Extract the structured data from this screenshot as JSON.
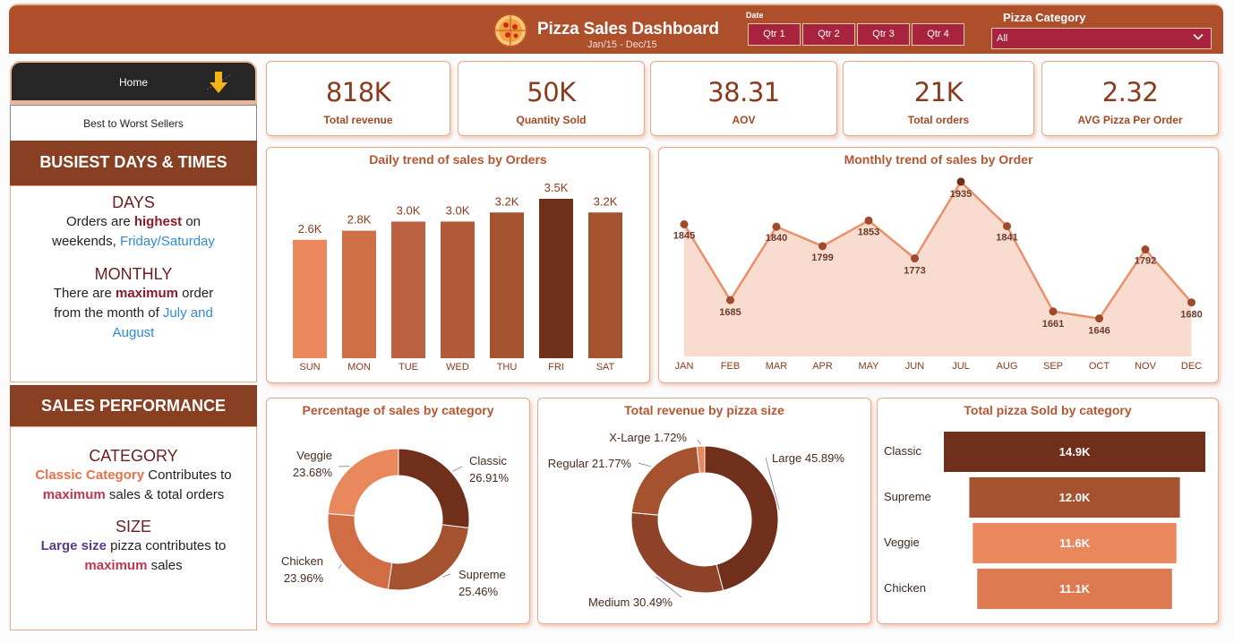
{
  "header": {
    "title": "Pizza Sales Dashboard",
    "subtitle": "Jan/15 - Dec/15",
    "date_label": "Date",
    "quarters": [
      "Qtr 1",
      "Qtr 2",
      "Qtr 3",
      "Qtr 4"
    ],
    "category_label": "Pizza Category",
    "category_value": "All"
  },
  "nav": {
    "home": "Home",
    "best": "Best to Worst Sellers"
  },
  "busiest": {
    "heading": "BUSIEST DAYS & TIMES",
    "days_title": "DAYS",
    "days_l1a": "Orders are ",
    "days_l1b": "highest",
    "days_l1c": " on",
    "days_l2a": "weekends, ",
    "days_l2b": "Friday/Saturday",
    "monthly_title": "MONTHLY",
    "mon_l1a": "There are ",
    "mon_l1b": "maximum",
    "mon_l1c": " order",
    "mon_l2a": "from the month of ",
    "mon_l2b": "July and",
    "mon_l3": "August"
  },
  "performance": {
    "heading": "SALES PERFORMANCE",
    "cat_title": "CATEGORY",
    "cat_l1a": "Classic Category",
    "cat_l1b": " Contributes to",
    "cat_l2a": "maximum",
    "cat_l2b": " sales & total orders",
    "size_title": "SIZE",
    "size_l1a": "Large size",
    "size_l1b": " pizza contributes to",
    "size_l2a": "maximum",
    "size_l2b": " sales"
  },
  "kpis": [
    {
      "value": "818K",
      "label": "Total revenue"
    },
    {
      "value": "50K",
      "label": "Quantity Sold"
    },
    {
      "value": "38.31",
      "label": "AOV"
    },
    {
      "value": "21K",
      "label": "Total orders"
    },
    {
      "value": "2.32",
      "label": "AVG Pizza Per Order"
    }
  ],
  "colors": {
    "header": "#ad4f2a",
    "dark": "#6f2f1a",
    "mid": "#a5522f",
    "light": "#e9885c",
    "area": "#f8dcd0",
    "line": "#e8916a"
  },
  "chart_data": [
    {
      "type": "bar",
      "title": "Daily trend of sales by Orders",
      "categories": [
        "SUN",
        "MON",
        "TUE",
        "WED",
        "THU",
        "FRI",
        "SAT"
      ],
      "values": [
        2.6,
        2.8,
        3.0,
        3.0,
        3.2,
        3.5,
        3.2
      ],
      "labels": [
        "2.6K",
        "2.8K",
        "3.0K",
        "3.0K",
        "3.2K",
        "3.5K",
        "3.2K"
      ],
      "colors": [
        "#e9885c",
        "#cf6f47",
        "#bb6040",
        "#b25a38",
        "#a5522f",
        "#6f2f1a",
        "#a5522f"
      ],
      "ylim": [
        0,
        3.5
      ]
    },
    {
      "type": "area",
      "title": "Monthly trend of sales by Order",
      "categories": [
        "JAN",
        "FEB",
        "MAR",
        "APR",
        "MAY",
        "JUN",
        "JUL",
        "AUG",
        "SEP",
        "OCT",
        "NOV",
        "DEC"
      ],
      "values": [
        1845,
        1685,
        1840,
        1799,
        1853,
        1773,
        1935,
        1841,
        1661,
        1646,
        1792,
        1680
      ]
    },
    {
      "type": "pie",
      "title": "Percentage of sales by category",
      "slices": [
        {
          "name": "Classic",
          "value": 26.91,
          "label": "26.91%",
          "color": "#6f2f1a"
        },
        {
          "name": "Supreme",
          "value": 25.46,
          "label": "25.46%",
          "color": "#a5522f"
        },
        {
          "name": "Chicken",
          "value": 23.96,
          "label": "23.96%",
          "color": "#d06d45"
        },
        {
          "name": "Veggie",
          "value": 23.68,
          "label": "23.68%",
          "color": "#e9885c"
        }
      ]
    },
    {
      "type": "pie",
      "title": "Total revenue by pizza size",
      "slices": [
        {
          "name": "Large",
          "value": 45.89,
          "label": "45.89%",
          "color": "#6f2f1a"
        },
        {
          "name": "Medium",
          "value": 30.49,
          "label": "30.49%",
          "color": "#8e4227"
        },
        {
          "name": "Regular",
          "value": 21.77,
          "label": "21.77%",
          "color": "#a5522f"
        },
        {
          "name": "X-Large",
          "value": 1.72,
          "label": "1.72%",
          "color": "#e9885c"
        }
      ]
    },
    {
      "type": "bar",
      "title": "Total pizza Sold by category",
      "categories": [
        "Classic",
        "Supreme",
        "Veggie",
        "Chicken"
      ],
      "values": [
        14.9,
        12.0,
        11.6,
        11.1
      ],
      "labels": [
        "14.9K",
        "12.0K",
        "11.6K",
        "11.1K"
      ],
      "colors": [
        "#6f2f1a",
        "#a5522f",
        "#e9885c",
        "#de7a52"
      ]
    }
  ]
}
